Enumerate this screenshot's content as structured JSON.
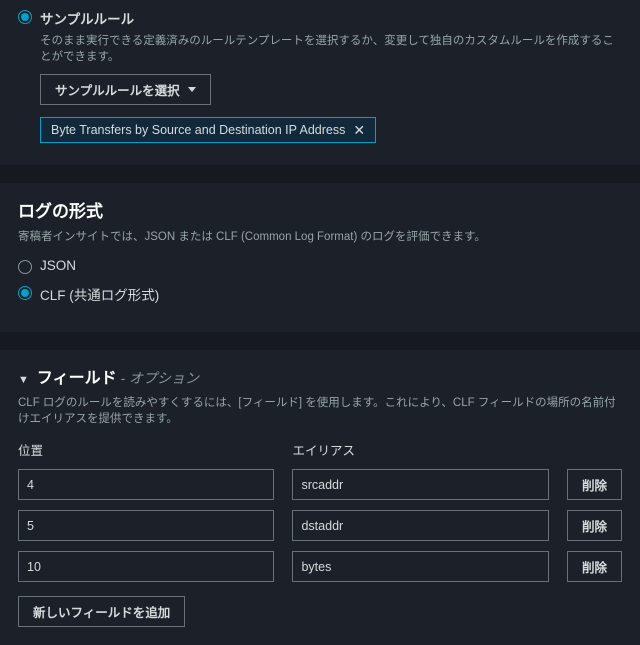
{
  "sample_rule": {
    "label": "サンプルルール",
    "description": "そのまま実行できる定義済みのルールテンプレートを選択するか、変更して独自のカスタムルールを作成することができます。",
    "select_button": "サンプルルールを選択",
    "selected_token": "Byte Transfers by Source and Destination IP Address"
  },
  "log_format": {
    "title": "ログの形式",
    "description": "寄稿者インサイトでは、JSON または CLF (Common Log Format) のログを評価できます。",
    "options": {
      "json": "JSON",
      "clf": "CLF (共通ログ形式)"
    }
  },
  "fields": {
    "title": "フィールド",
    "suffix": " - オプション",
    "description": "CLF ログのルールを読みやすくするには、[フィールド] を使用します。これにより、CLF フィールドの場所の名前付けエイリアスを提供できます。",
    "col_position": "位置",
    "col_alias": "エイリアス",
    "delete_label": "削除",
    "rows": [
      {
        "position": "4",
        "alias": "srcaddr"
      },
      {
        "position": "5",
        "alias": "dstaddr"
      },
      {
        "position": "10",
        "alias": "bytes"
      }
    ],
    "add_button": "新しいフィールドを追加"
  }
}
